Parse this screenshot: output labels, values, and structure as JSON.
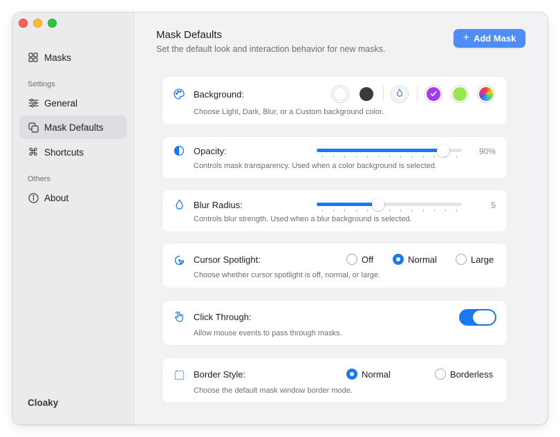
{
  "sidebar": {
    "items": [
      {
        "label": "Masks"
      },
      {
        "label": "General"
      },
      {
        "label": "Mask Defaults"
      },
      {
        "label": "Shortcuts"
      },
      {
        "label": "About"
      }
    ],
    "sections": {
      "settings": "Settings",
      "others": "Others"
    },
    "app_name": "Cloaky"
  },
  "header": {
    "title": "Mask Defaults",
    "subtitle": "Set the default look and interaction behavior for new masks.",
    "add_button": "Add Mask"
  },
  "background": {
    "label": "Background:",
    "description": "Choose Light, Dark, Blur, or a Custom background color.",
    "swatches": [
      {
        "name": "light",
        "color": "#ffffff"
      },
      {
        "name": "dark",
        "color": "#3a3a3e"
      },
      {
        "name": "blur",
        "color": "#ffffff"
      },
      {
        "name": "purple",
        "color": "#a23bf0",
        "selected": true
      },
      {
        "name": "green",
        "color": "#97e84f"
      },
      {
        "name": "custom",
        "color": "conic-gradient"
      }
    ]
  },
  "opacity": {
    "label": "Opacity:",
    "description": "Controls mask transparency. Used when a color background is selected.",
    "value": 90,
    "value_text": "90%"
  },
  "blur": {
    "label": "Blur Radius:",
    "description": "Controls blur strength. Used when a blur background is selected.",
    "value": 5,
    "min": 0,
    "max": 12,
    "value_text": "5"
  },
  "cursor": {
    "label": "Cursor Spotlight:",
    "description": "Choose whether cursor spotlight is off, normal, or large.",
    "options": [
      "Off",
      "Normal",
      "Large"
    ],
    "selected": "Normal"
  },
  "click_through": {
    "label": "Click Through:",
    "description": "Allow mouse events to pass through masks.",
    "enabled": true
  },
  "border": {
    "label": "Border Style:",
    "description": "Choose the default mask window border mode.",
    "options": [
      "Normal",
      "Borderless"
    ],
    "selected": "Normal"
  },
  "colors": {
    "accent": "#1a78f2",
    "button": "#4f8df6"
  }
}
